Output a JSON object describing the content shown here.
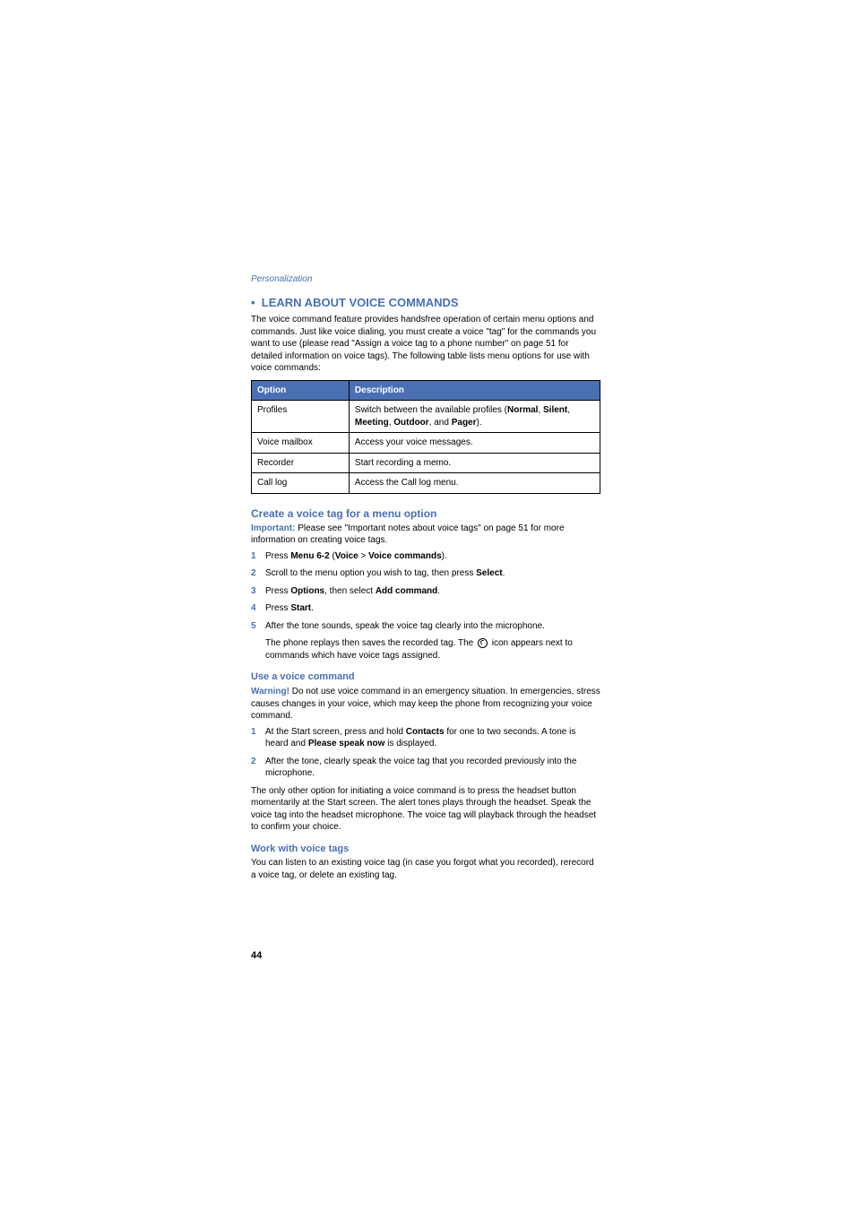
{
  "breadcrumb": "Personalization",
  "section_heading": "LEARN ABOUT VOICE COMMANDS",
  "intro": "The voice command feature provides handsfree operation of certain menu options and commands. Just like voice dialing, you must create a voice \"tag\" for the commands you want to use (please read \"Assign a voice tag to a phone number\" on page 51 for detailed information on voice tags). The following table lists menu options for use with voice commands:",
  "table": {
    "headers": {
      "option": "Option",
      "description": "Description"
    },
    "rows": [
      {
        "option": "Profiles",
        "desc_prefix": "Switch between the available profiles (",
        "desc_bold": "Normal",
        "desc_mid1": ", ",
        "desc_bold2": "Silent",
        "desc_mid2": ", ",
        "desc_bold3": "Meeting",
        "desc_mid3": ", ",
        "desc_bold4": "Outdoor",
        "desc_mid4": ", and ",
        "desc_bold5": "Pager",
        "desc_suffix": ")."
      },
      {
        "option": "Voice mailbox",
        "desc": "Access your voice messages."
      },
      {
        "option": "Recorder",
        "desc": "Start recording a memo."
      },
      {
        "option": "Call log",
        "desc": "Access the Call log menu."
      }
    ]
  },
  "create": {
    "heading": "Create a voice tag for a menu option",
    "important_label": "Important:",
    "important_text": " Please see \"Important notes about voice tags\" on page 51 for more information on creating voice tags.",
    "steps": [
      {
        "pre": "Press ",
        "b1": "Menu 6-2",
        "mid1": " (",
        "b2": "Voice",
        "mid2": " > ",
        "b3": "Voice commands",
        "post": ")."
      },
      {
        "pre": "Scroll to the menu option you wish to tag, then press ",
        "b1": "Select",
        "post": "."
      },
      {
        "pre": "Press ",
        "b1": "Options",
        "mid1": ", then select ",
        "b2": "Add command",
        "post": "."
      },
      {
        "pre": "Press ",
        "b1": "Start",
        "post": "."
      },
      {
        "pre": "After the tone sounds, speak the voice tag clearly into the microphone."
      }
    ],
    "note_pre": "The phone replays then saves the recorded tag. The ",
    "note_post": " icon appears next to commands which have voice tags assigned."
  },
  "use": {
    "heading": "Use a voice command",
    "warning_label": "Warning!",
    "warning_text": " Do not use voice command in an emergency situation. In emergencies, stress causes changes in your voice, which may keep the phone from recognizing your voice command.",
    "steps": [
      {
        "pre": "At the Start screen, press and hold ",
        "b1": "Contacts",
        "mid1": " for one to two seconds. A tone is heard and ",
        "b2": "Please speak now",
        "post": " is displayed."
      },
      {
        "pre": "After the tone, clearly speak the voice tag that you recorded previously into the microphone."
      }
    ],
    "footer": "The only other option for initiating a voice command is to press the headset button momentarily at the Start screen. The alert tones plays through the headset. Speak the voice tag into the headset microphone. The voice tag will playback through the headset to confirm your choice."
  },
  "work": {
    "heading": "Work with voice tags",
    "text": "You can listen to an existing voice tag (in case you forgot what you recorded), rerecord a voice tag, or delete an existing tag."
  },
  "page_number": "44"
}
